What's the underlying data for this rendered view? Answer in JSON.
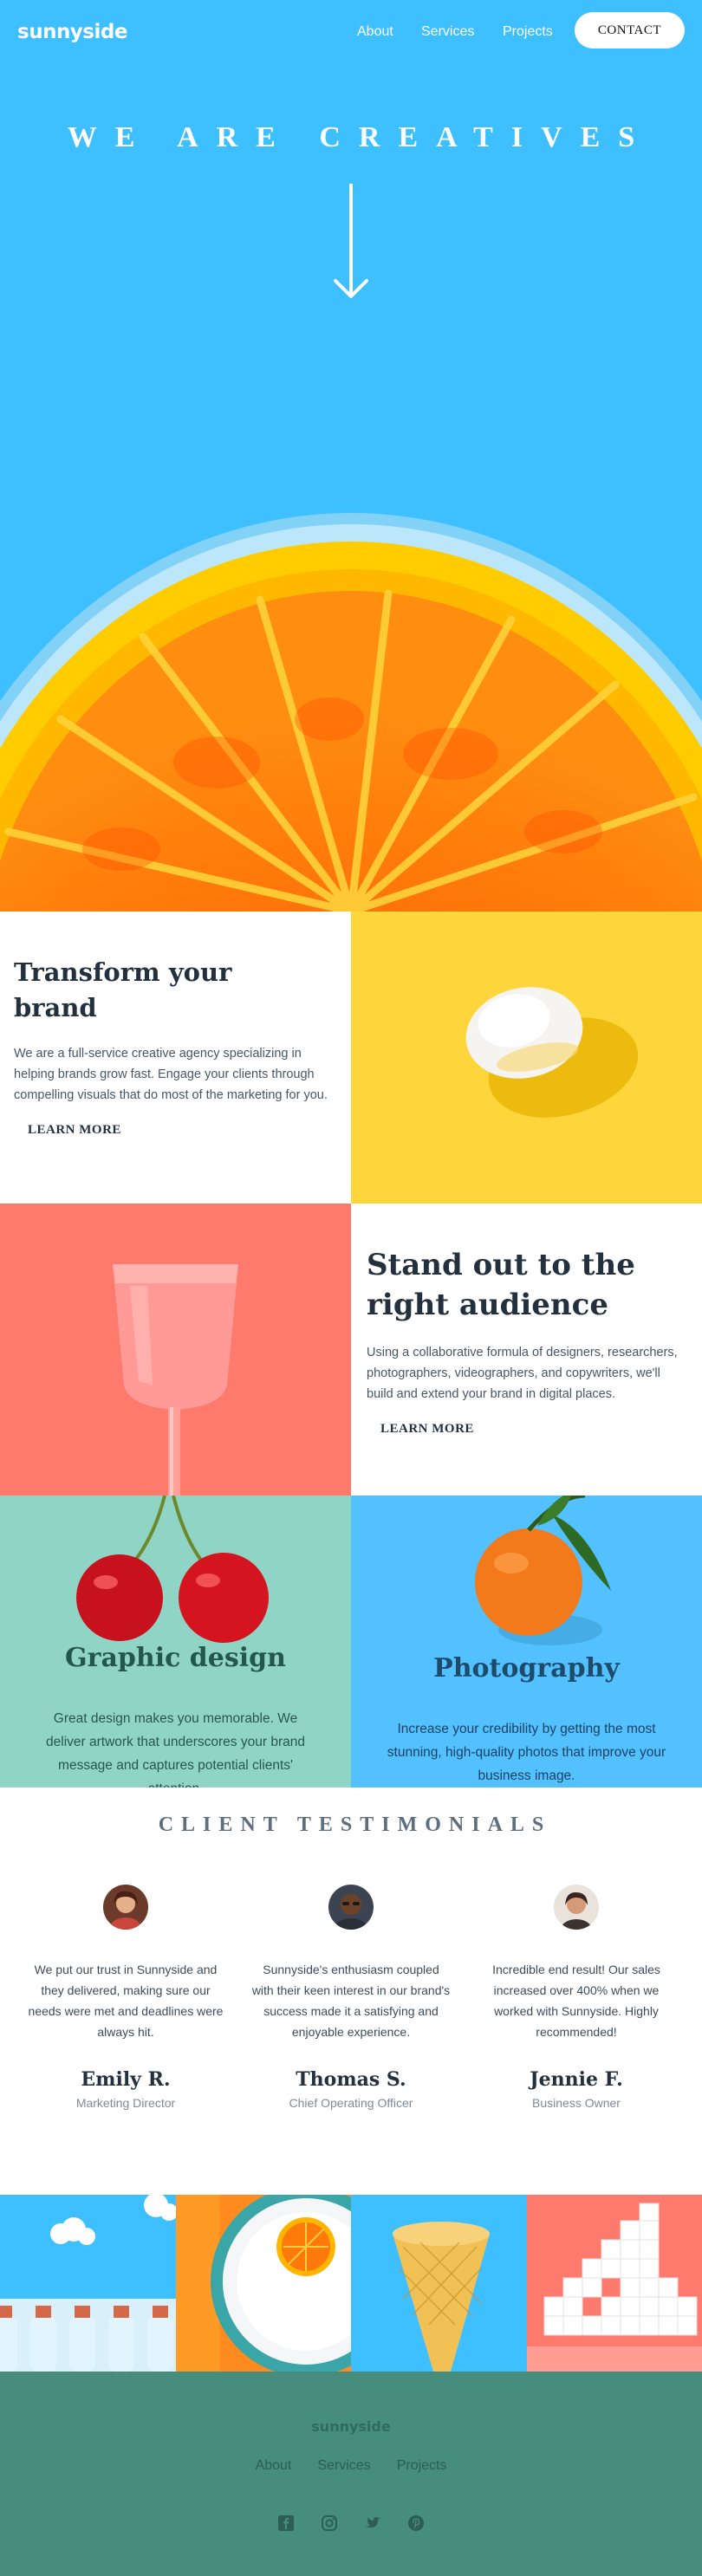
{
  "nav": {
    "logo": "sunnyside",
    "links": [
      "About",
      "Services",
      "Projects"
    ],
    "contact": "CONTACT"
  },
  "hero": {
    "title": "WE ARE CREATIVES"
  },
  "brand": {
    "title": "Transform your brand",
    "body": "We are a full-service creative agency specializing in helping brands grow fast. Engage your clients through compelling visuals that do most of the marketing for you.",
    "cta": "LEARN MORE"
  },
  "audience": {
    "title": "Stand out to the right audience",
    "body": "Using a collaborative formula of designers, researchers, photographers, videographers, and copywriters, we'll build and extend your brand in digital places.",
    "cta": "LEARN MORE"
  },
  "services": {
    "graphic": {
      "title": "Graphic design",
      "body": "Great design makes you memorable. We deliver artwork that underscores your brand message and captures potential clients' attention."
    },
    "photo": {
      "title": "Photography",
      "body": "Increase your credibility by getting the most stunning, high-quality photos that improve your business image."
    }
  },
  "testimonials": {
    "title": "CLIENT TESTIMONIALS",
    "items": [
      {
        "quote": "We put our trust in Sunnyside and they delivered, making sure our needs were met and deadlines were always hit.",
        "name": "Emily R.",
        "role": "Marketing Director"
      },
      {
        "quote": "Sunnyside's enthusiasm coupled with their keen interest in our brand's success made it a satisfying and enjoyable experience.",
        "name": "Thomas S.",
        "role": "Chief Operating Officer"
      },
      {
        "quote": "Incredible end result! Our sales increased over 400% when we worked with Sunnyside. Highly recommended!",
        "name": "Jennie F.",
        "role": "Business Owner"
      }
    ]
  },
  "footer": {
    "logo": "sunnyside",
    "links": [
      "About",
      "Services",
      "Projects"
    ],
    "social_icons": [
      "facebook-icon",
      "instagram-icon",
      "twitter-icon",
      "pinterest-icon"
    ]
  },
  "colors": {
    "hero_bg": "#3ebfff",
    "brand_bg_yellow": "#fed63b",
    "audience_bg_pink": "#fe7a6c",
    "graphic_bg": "#90d4c5",
    "photo_bg": "#53c0ff",
    "footer_bg": "#478d7e"
  }
}
